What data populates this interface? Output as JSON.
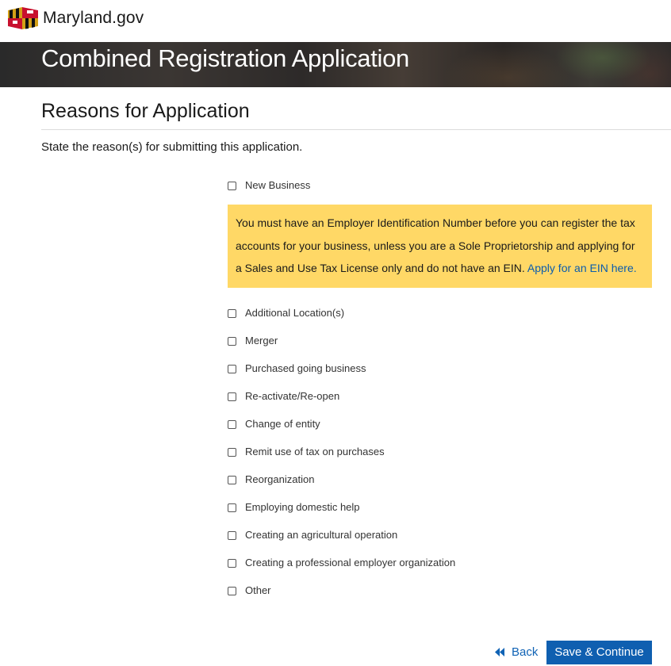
{
  "header": {
    "logo_text": "Maryland.gov",
    "banner_title": "Combined Registration Application"
  },
  "section": {
    "title": "Reasons for Application",
    "intro": "State the reason(s) for submitting this application."
  },
  "options": {
    "new_business": "New Business",
    "additional_locations": "Additional Location(s)",
    "merger": "Merger",
    "purchased_going_business": "Purchased going business",
    "reactivate": "Re-activate/Re-open",
    "change_of_entity": "Change of entity",
    "remit_use_tax": "Remit use of tax on purchases",
    "reorganization": "Reorganization",
    "employing_domestic_help": "Employing domestic help",
    "agricultural_operation": "Creating an agricultural operation",
    "professional_employer_org": "Creating a professional employer organization",
    "other": "Other"
  },
  "notice": {
    "text": "You must have an Employer Identification Number before you can register the tax accounts for your business, unless you are a Sole Proprietorship and applying for a Sales and Use Tax License only and do not have an EIN.",
    "link_text": "Apply for an EIN here."
  },
  "actions": {
    "back_label": "Back",
    "save_label": "Save & Continue"
  },
  "colors": {
    "notice_bg": "#ffd866",
    "primary": "#0f5fb0",
    "link": "#0b5cad"
  }
}
